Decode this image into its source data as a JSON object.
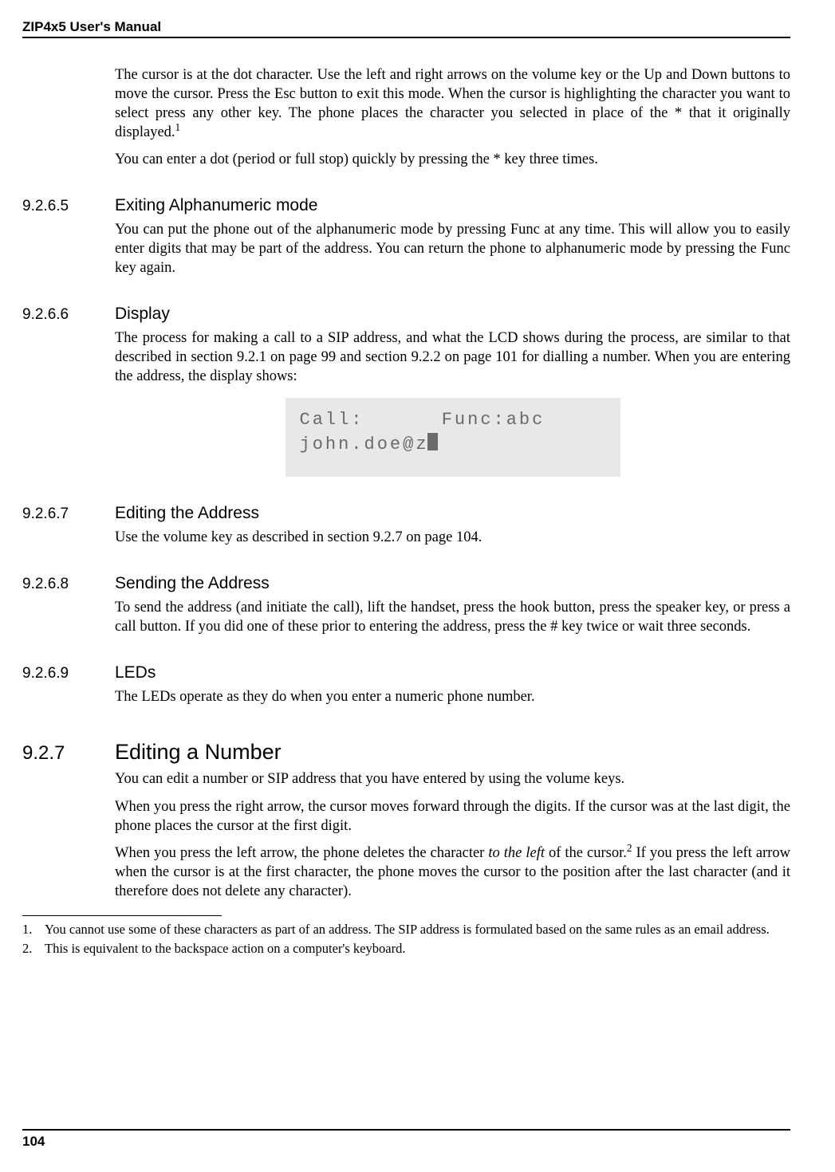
{
  "header": {
    "title": "ZIP4x5 User's Manual"
  },
  "intro": {
    "p1_a": "The cursor is at the dot character. Use the left and right arrows on the volume key or the Up and Down buttons to move the cursor. Press the Esc button to exit this mode. When the cursor is highlighting the character you want to select press any other key. The phone places the character you selected in place of the * that it originally displayed.",
    "p1_sup": "1",
    "p2": "You can enter a dot (period or full stop) quickly by pressing the * key three times."
  },
  "s9265": {
    "num": "9.2.6.5",
    "title": "Exiting Alphanumeric mode",
    "p1": "You can put the phone out of the alphanumeric mode by pressing Func at any time. This will allow you to easily enter digits that may be part of the address. You can return the phone to alphanumeric mode by pressing the Func key again."
  },
  "s9266": {
    "num": "9.2.6.6",
    "title": "Display",
    "p1": "The process for making a call to a SIP address, and what the LCD shows during the process, are similar to that described in section 9.2.1 on page 99 and section 9.2.2 on page 101 for dialling a number. When you are entering the address, the display shows:"
  },
  "lcd": {
    "line1": "Call:      Func:abc",
    "line2": "john.doe@z"
  },
  "s9267": {
    "num": "9.2.6.7",
    "title": "Editing the Address",
    "p1": "Use the volume key as described in section 9.2.7 on page 104."
  },
  "s9268": {
    "num": "9.2.6.8",
    "title": "Sending the Address",
    "p1": "To send the address (and initiate the call), lift the handset, press the hook button, press the speaker key, or press a call button. If you did one of these prior to entering the address, press the # key twice or wait three seconds."
  },
  "s9269": {
    "num": "9.2.6.9",
    "title": "LEDs",
    "p1": "The LEDs operate as they do when you enter a numeric phone number."
  },
  "s927": {
    "num": "9.2.7",
    "title": "Editing a Number",
    "p1": "You can edit a number or SIP address that you have entered by using the volume keys.",
    "p2": "When you press the right arrow, the cursor moves forward through the digits. If the cursor was at the last digit, the phone places the cursor at the first digit.",
    "p3a": "When you press the left arrow, the phone deletes the character ",
    "p3_ital": "to the left",
    "p3b": " of the cursor.",
    "p3_sup": "2",
    "p3c": " If you press the left arrow when the cursor is at the first character, the phone moves the cursor to the position after the last character (and it therefore does not delete any character)."
  },
  "footnotes": {
    "f1n": "1.",
    "f1": "You cannot use some of these characters as part of an address. The SIP address is formulated based on the same rules as an email address.",
    "f2n": "2.",
    "f2": "This is equivalent to the backspace action on a computer's keyboard."
  },
  "footer": {
    "page": "104"
  }
}
